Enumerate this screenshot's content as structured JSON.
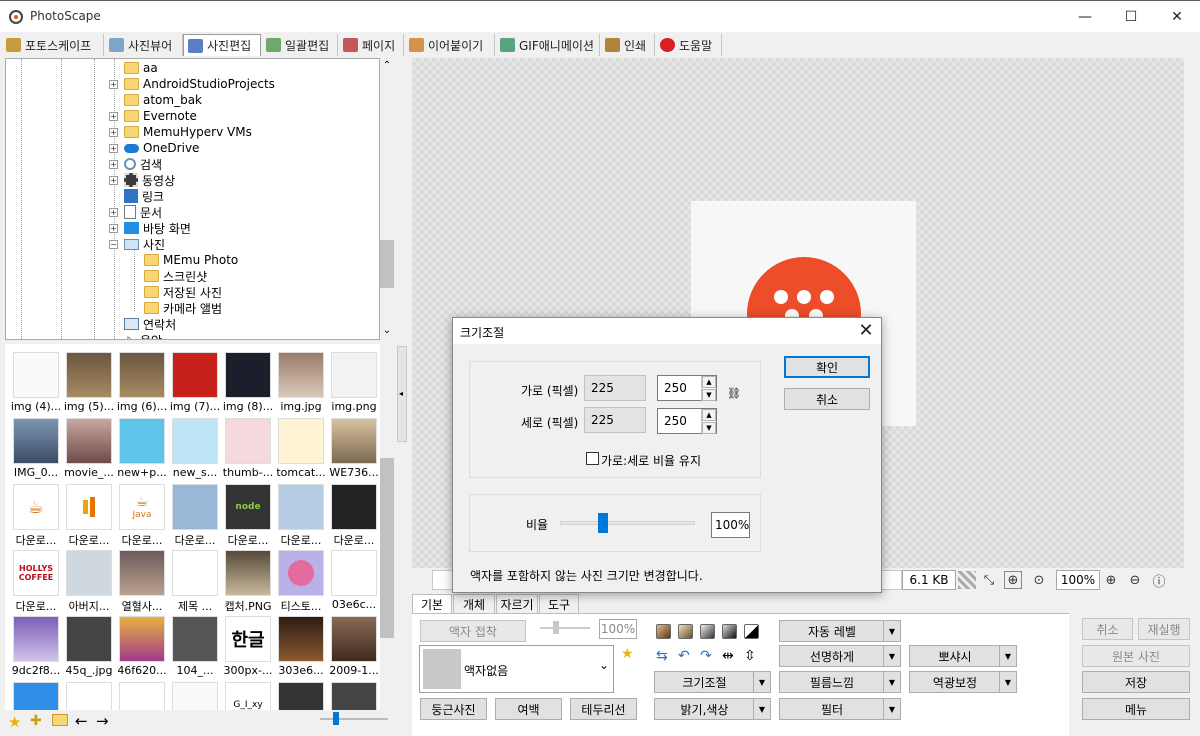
{
  "window": {
    "title": "PhotoScape",
    "minimize": "—",
    "maximize": "☐",
    "close": "✕"
  },
  "tabs": [
    {
      "label": "포토스케이프"
    },
    {
      "label": "사진뷰어"
    },
    {
      "label": "사진편집"
    },
    {
      "label": "일괄편집"
    },
    {
      "label": "페이지"
    },
    {
      "label": "이어붙이기"
    },
    {
      "label": "GIF애니메이션"
    },
    {
      "label": "인쇄"
    },
    {
      "label": "도움말"
    }
  ],
  "tree": {
    "items": [
      {
        "label": "aa"
      },
      {
        "label": "AndroidStudioProjects"
      },
      {
        "label": "atom_bak"
      },
      {
        "label": "Evernote"
      },
      {
        "label": "MemuHyperv VMs"
      },
      {
        "label": "OneDrive"
      },
      {
        "label": "검색"
      },
      {
        "label": "동영상"
      },
      {
        "label": "링크"
      },
      {
        "label": "문서"
      },
      {
        "label": "바탕 화면"
      },
      {
        "label": "사진"
      },
      {
        "label": "MEmu Photo"
      },
      {
        "label": "스크린샷"
      },
      {
        "label": "저장된 사진"
      },
      {
        "label": "카메라 앨범"
      },
      {
        "label": "연락처"
      },
      {
        "label": "음악"
      }
    ]
  },
  "thumbnails": [
    {
      "caption": "img (4)..."
    },
    {
      "caption": "img (5)..."
    },
    {
      "caption": "img (6)..."
    },
    {
      "caption": "img (7)..."
    },
    {
      "caption": "img (8)..."
    },
    {
      "caption": "img.jpg"
    },
    {
      "caption": "img.png"
    },
    {
      "caption": "IMG_0..."
    },
    {
      "caption": "movie_..."
    },
    {
      "caption": "new+p..."
    },
    {
      "caption": "new_s..."
    },
    {
      "caption": "thumb-..."
    },
    {
      "caption": "tomcat..."
    },
    {
      "caption": "WE736..."
    },
    {
      "caption": "다운로..."
    },
    {
      "caption": "다운로..."
    },
    {
      "caption": "다운로..."
    },
    {
      "caption": "다운로..."
    },
    {
      "caption": "다운로..."
    },
    {
      "caption": "다운로..."
    },
    {
      "caption": "다운로..."
    },
    {
      "caption": "다운로..."
    },
    {
      "caption": "아버지..."
    },
    {
      "caption": "열혈사..."
    },
    {
      "caption": "제목 ..."
    },
    {
      "caption": "캡처.PNG"
    },
    {
      "caption": "티스토..."
    },
    {
      "caption": "03e6c..."
    },
    {
      "caption": "9dc2f8..."
    },
    {
      "caption": "45q_.jpg"
    },
    {
      "caption": "46f620..."
    },
    {
      "caption": "104_..."
    },
    {
      "caption": "300px-..."
    },
    {
      "caption": "303e6..."
    },
    {
      "caption": "2009-1..."
    }
  ],
  "thumb_text": {
    "hollys": "HOLLYS COFFEE",
    "java": "Java",
    "node": "node",
    "hangul": "한글",
    "file": "G_I_xy"
  },
  "status": {
    "filesize": "6.1 KB",
    "zoom": "100%"
  },
  "edit_tabs": [
    {
      "label": "기본"
    },
    {
      "label": "개체"
    },
    {
      "label": "자르기"
    },
    {
      "label": "도구"
    }
  ],
  "edit": {
    "frame_fit": "액자 접착",
    "frame_percent": "100%",
    "frame_select": "액자없음",
    "round_photo": "둥근사진",
    "margin": "여백",
    "border": "테두리선",
    "resize": "크기조절",
    "brightness": "밝기,색상",
    "auto_level": "자동 레벨",
    "sharpen": "선명하게",
    "film": "필름느낌",
    "filter": "필터",
    "bloom": "뽀샤시",
    "backlight": "역광보정"
  },
  "right_buttons": {
    "undo": "취소",
    "redo": "재실행",
    "original": "원본 사진",
    "save": "저장",
    "menu": "메뉴"
  },
  "dialog": {
    "title": "크기조절",
    "width_label": "가로 (픽셀)",
    "height_label": "세로 (픽셀)",
    "width_current": "225",
    "height_current": "225",
    "width_new": "250",
    "height_new": "250",
    "keep_ratio": "가로:세로 비율 유지",
    "ratio_label": "비율",
    "ratio_value": "100%",
    "ok": "확인",
    "cancel": "취소",
    "note": "액자를 포함하지 않는 사진 크기만 변경합니다."
  },
  "colors": {
    "accent": "#0078d7",
    "photo_circle": "#ee4d2a",
    "folder": "#f8d673"
  }
}
